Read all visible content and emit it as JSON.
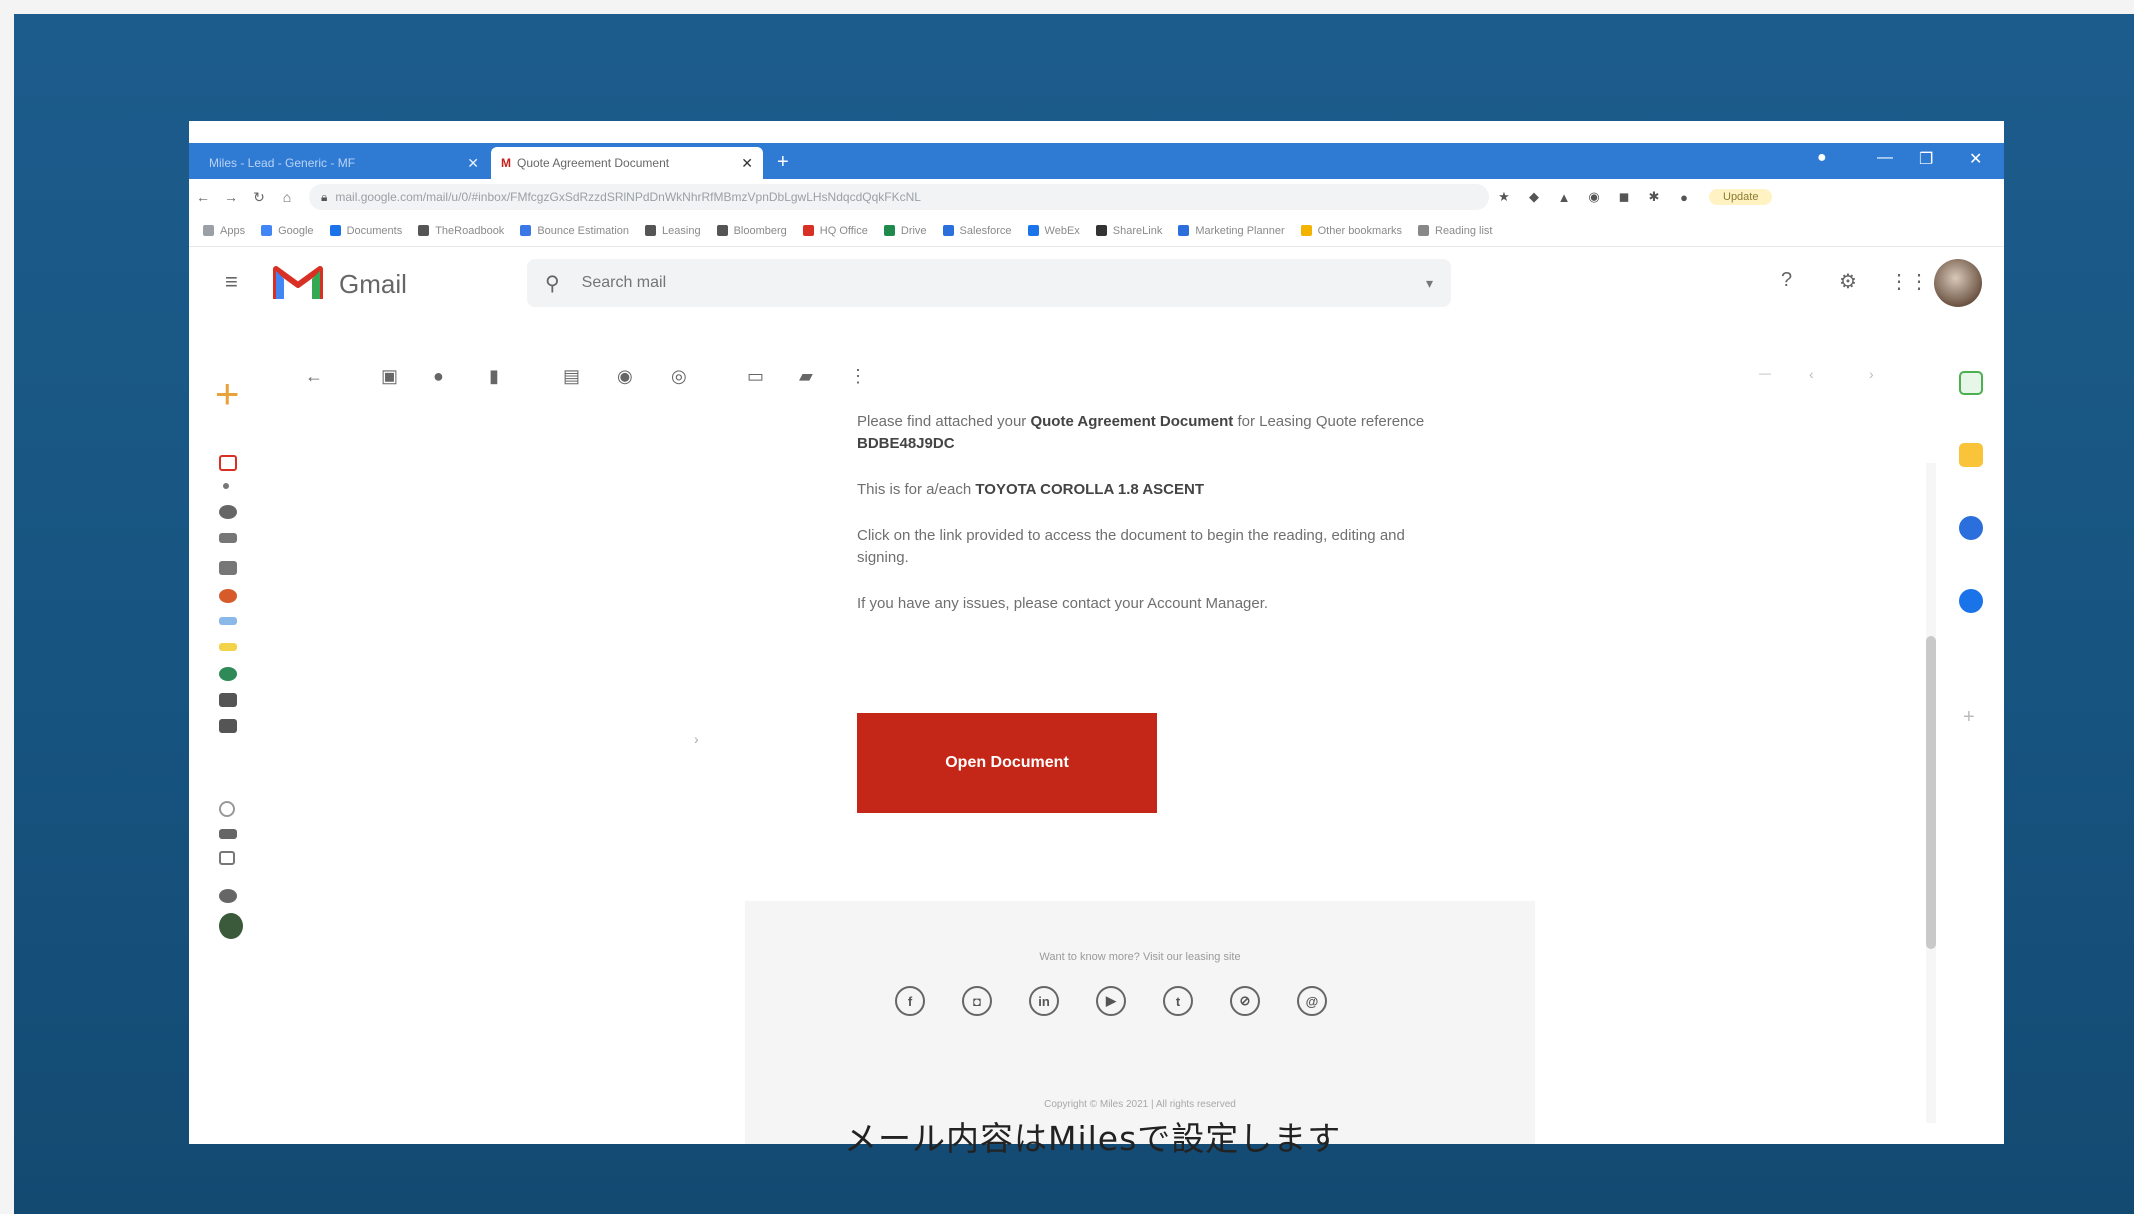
{
  "browser": {
    "tabs": [
      {
        "label": "Miles - Lead - Generic - MF",
        "active": false
      },
      {
        "label": "Quote Agreement Document",
        "active": true
      }
    ],
    "url": "mail.google.com/mail/u/0/#inbox/FMfcgzGxSdRzzdSRlNPdDnWkNhrRfMBmzVpnDbLgwLHsNdqcdQqkFKcNL",
    "bookmarks": [
      "Apps",
      "Google",
      "Documents",
      "TheRoadbook",
      "Bounce Estimation",
      "Leasing",
      "Bloomberg",
      "HQ Office",
      "Drive",
      "Salesforce",
      "WebEx",
      "ShareLink",
      "Marketing Planner",
      "Other bookmarks",
      "Reading list"
    ],
    "extension_label": "Update"
  },
  "gmail": {
    "app_name": "Gmail",
    "search_placeholder": "Search mail"
  },
  "email": {
    "para1_prefix": "Please find attached your",
    "para1_bold": "Quote Agreement Document",
    "para1_suffix": "for Leasing Quote reference",
    "para1_ref": "BDBE48J9DC",
    "para2_prefix": "This is for a/each",
    "para2_bold": "TOYOTA COROLLA 1.8 ASCENT",
    "para3": "Click on the link provided to access the document to begin the reading, editing and signing.",
    "para4": "If you have any issues, please contact your Account Manager.",
    "button_label": "Open Document",
    "footer_text": "Want to know more? Visit our leasing site",
    "copyright": "Copyright © Miles 2021 | All rights reserved"
  },
  "social_icons": [
    "facebook-icon",
    "instagram-icon",
    "linkedin-icon",
    "youtube-icon",
    "twitter-icon",
    "website-icon",
    "email-icon"
  ],
  "caption": "メール内容はMilesで設定します",
  "colors": {
    "frame": "#17537f",
    "tabstrip": "#2f7bd4",
    "button": "#c42617",
    "compose": "#e8a23a"
  }
}
